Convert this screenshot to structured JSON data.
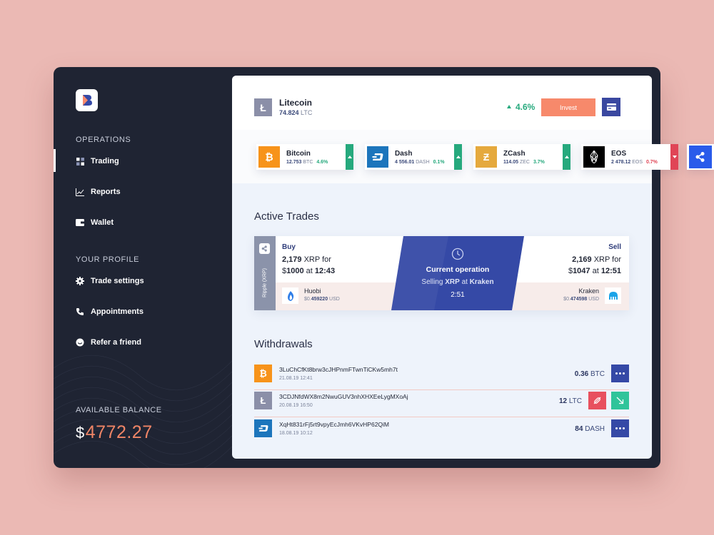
{
  "sidebar": {
    "operations_title": "OPERATIONS",
    "profile_title": "YOUR PROFILE",
    "items": [
      {
        "label": "Trading",
        "icon": "grid-icon"
      },
      {
        "label": "Reports",
        "icon": "chart-icon"
      },
      {
        "label": "Wallet",
        "icon": "wallet-icon"
      },
      {
        "label": "Trade settings",
        "icon": "gear-icon"
      },
      {
        "label": "Appointments",
        "icon": "phone-icon"
      },
      {
        "label": "Refer a friend",
        "icon": "smile-icon"
      }
    ],
    "balance_label": "AVAILABLE BALANCE",
    "balance_currency": "$",
    "balance_value": "4772.27"
  },
  "header": {
    "coin_name": "Litecoin",
    "coin_amount": "74.824",
    "coin_unit": "LTC",
    "change": "4.6%",
    "invest_label": "Invest"
  },
  "coins": [
    {
      "name": "Bitcoin",
      "amount": "12.753",
      "unit": "BTC",
      "change": "4.6%",
      "dir": "up",
      "color": "#f7931a"
    },
    {
      "name": "Dash",
      "amount": "4 556.01",
      "unit": "DASH",
      "change": "0.1%",
      "dir": "up",
      "color": "#1c75bc"
    },
    {
      "name": "ZCash",
      "amount": "114.05",
      "unit": "ZEC",
      "change": "3.7%",
      "dir": "up",
      "color": "#e5a93d"
    },
    {
      "name": "EOS",
      "amount": "2 478.12",
      "unit": "EOS",
      "change": "0.7%",
      "dir": "down",
      "color": "#000000"
    }
  ],
  "active_trades": {
    "title": "Active Trades",
    "side_label": "Ripple (XRP)",
    "buy": {
      "label": "Buy",
      "amount": "2,179",
      "text1": "XRP for",
      "price": "1000",
      "at": "at",
      "time": "12:43",
      "currency": "$"
    },
    "sell": {
      "label": "Sell",
      "amount": "2,169",
      "text1": "XRP for",
      "price": "1047",
      "at": "at",
      "time": "12:51",
      "currency": "$"
    },
    "buy_exchange": {
      "name": "Huobi",
      "price_prefix": "$0.",
      "price_bold": "459220",
      "unit": "USD"
    },
    "sell_exchange": {
      "name": "Kraken",
      "price_prefix": "$0.",
      "price_bold": "474598",
      "unit": "USD"
    },
    "current": {
      "title": "Current operation",
      "sub_prefix": "Selling",
      "sub_bold": "XRP",
      "sub_mid": "at",
      "sub_exchange": "Kraken",
      "time": "2:51"
    }
  },
  "withdrawals": {
    "title": "Withdrawals",
    "rows": [
      {
        "address": "3LuChCfKt8brw3cJHPnmFTwnTiCKw5mh7t",
        "date": "21.08.19 12:41",
        "amount": "0.36",
        "unit": "BTC",
        "icon_color": "#f7931a"
      },
      {
        "address": "3CDJNfdWX8m2NwuGUV3nhXHXEeLygMXoAj",
        "date": "20.08.19 16:50",
        "amount": "12",
        "unit": "LTC",
        "icon_color": "#8b8fa8"
      },
      {
        "address": "XqHt831rFj5rt9vpyEcJmh6VKvHP62QiM",
        "date": "18.08.19 10:12",
        "amount": "84",
        "unit": "DASH",
        "icon_color": "#1c75bc"
      }
    ]
  },
  "colors": {
    "accent": "#f7896b",
    "brand": "#3549a6",
    "up": "#26a97d",
    "down": "#e04556"
  }
}
